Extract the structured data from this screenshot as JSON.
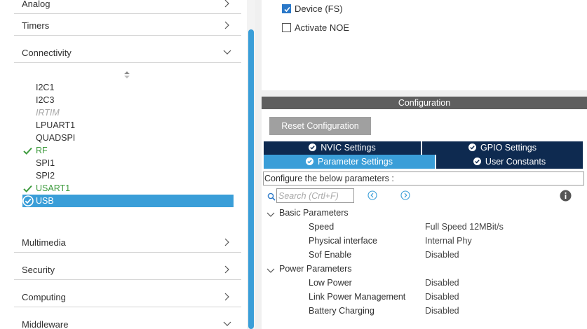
{
  "left_panel": {
    "categories": {
      "analog": "Analog",
      "timers": "Timers",
      "connectivity": "Connectivity",
      "multimedia": "Multimedia",
      "security": "Security",
      "computing": "Computing",
      "middleware": "Middleware"
    },
    "peripherals": [
      {
        "name": "I2C1",
        "state": "normal"
      },
      {
        "name": "I2C3",
        "state": "normal"
      },
      {
        "name": "IRTIM",
        "state": "disabled"
      },
      {
        "name": "LPUART1",
        "state": "normal"
      },
      {
        "name": "QUADSPI",
        "state": "normal"
      },
      {
        "name": "RF",
        "state": "configured"
      },
      {
        "name": "SPI1",
        "state": "normal"
      },
      {
        "name": "SPI2",
        "state": "normal"
      },
      {
        "name": "USART1",
        "state": "configured"
      },
      {
        "name": "USB",
        "state": "selected"
      }
    ]
  },
  "mode": {
    "device_fs": {
      "label": "Device (FS)",
      "checked": true
    },
    "activate_noe": {
      "label": "Activate NOE",
      "checked": false
    }
  },
  "configuration": {
    "header": "Configuration",
    "reset_button": "Reset Configuration",
    "tabs": {
      "nvic": "NVIC Settings",
      "gpio": "GPIO Settings",
      "parameter": "Parameter Settings",
      "user_constants": "User Constants"
    },
    "description": "Configure the below parameters :",
    "search_placeholder": "Search (Crtl+F)",
    "groups": {
      "basic": {
        "label": "Basic Parameters",
        "params": [
          {
            "name": "Speed",
            "value": "Full Speed 12MBit/s"
          },
          {
            "name": "Physical interface",
            "value": "Internal Phy"
          },
          {
            "name": "Sof Enable",
            "value": "Disabled"
          }
        ]
      },
      "power": {
        "label": "Power Parameters",
        "params": [
          {
            "name": "Low Power",
            "value": "Disabled"
          },
          {
            "name": "Link Power Management",
            "value": "Disabled"
          },
          {
            "name": "Battery Charging",
            "value": "Disabled"
          }
        ]
      }
    }
  },
  "colors": {
    "accent": "#3a9ed8",
    "tab_dark": "#0e2a50",
    "configured_green": "#3c9a3c",
    "header_gray": "#5e5e5e"
  }
}
